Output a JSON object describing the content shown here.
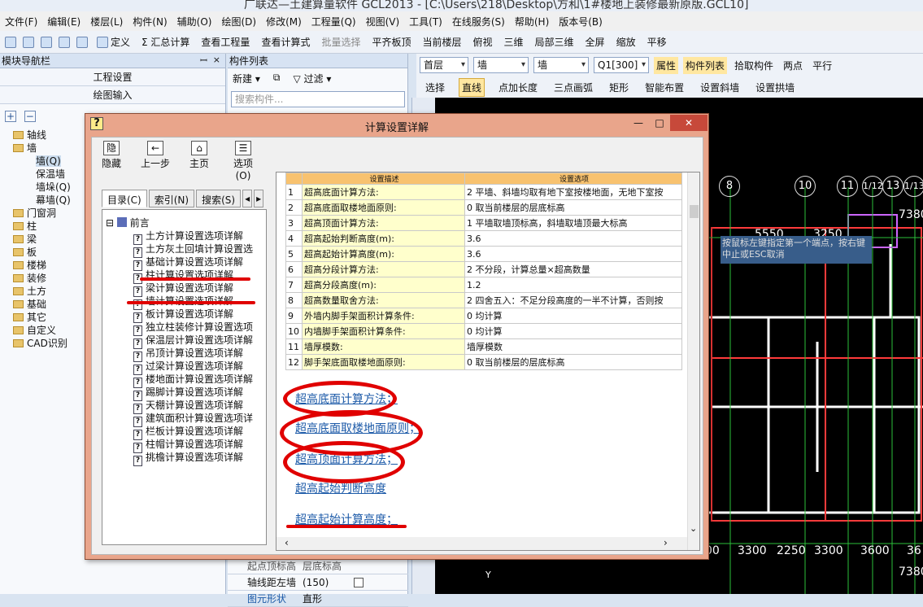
{
  "app": {
    "title": "广联达—土建算量软件 GCL2013 - [C:\\Users\\218\\Desktop\\方和\\1#楼地上装修最新原版.GCL10]"
  },
  "menu": [
    "文件(F)",
    "编辑(E)",
    "楼层(L)",
    "构件(N)",
    "辅助(O)",
    "绘图(D)",
    "修改(M)",
    "工程量(Q)",
    "视图(V)",
    "工具(T)",
    "在线服务(S)",
    "帮助(H)",
    "版本号(B)"
  ],
  "toolbar1": [
    "定义",
    "Σ 汇总计算",
    "查看工程量",
    "查看计算式",
    "批量选择",
    "平齐板顶",
    "当前楼层",
    "俯视",
    "三维",
    "局部三维",
    "全屏",
    "缩放",
    "平移"
  ],
  "cad_toolbar": {
    "floor": "首层",
    "type1": "墙",
    "type2": "墙",
    "component": "Q1[300]",
    "btns": [
      "属性",
      "构件列表",
      "拾取构件",
      "两点",
      "平行"
    ],
    "row2": [
      "选择",
      "直线",
      "点加长度",
      "三点画弧",
      "矩形",
      "智能布置",
      "设置斜墙",
      "设置拱墙"
    ]
  },
  "nav_panel": {
    "title": "模块导航栏",
    "btn1": "工程设置",
    "btn2": "绘图输入",
    "tree": [
      "轴线",
      "墙",
      "墙(Q)",
      "保温墙",
      "墙垛(Q)",
      "幕墙(Q)",
      "门窗洞",
      "柱",
      "梁",
      "板",
      "楼梯",
      "装修",
      "土方",
      "基础",
      "其它",
      "自定义",
      "CAD识别"
    ]
  },
  "comp_panel": {
    "title": "构件列表",
    "new_btn": "新建",
    "filter_btn": "过滤",
    "search_placeholder": "搜索构件...",
    "rows": [
      {
        "label": "轴线距左墙",
        "value": "(150)"
      },
      {
        "label": "图元形状",
        "value": "直形"
      }
    ],
    "partial_row": {
      "label": "起点顶标高",
      "value": "层底标高"
    }
  },
  "dialog": {
    "title": "计算设置详解",
    "tools": [
      {
        "icon": "隐",
        "label": "隐藏"
      },
      {
        "icon": "←",
        "label": "上一步"
      },
      {
        "icon": "⌂",
        "label": "主页"
      },
      {
        "icon": "☰",
        "label": "选项(O)"
      }
    ],
    "tabs": [
      "目录(C)",
      "索引(N)",
      "搜索(S)"
    ],
    "toc_root": "前言",
    "toc_items": [
      "土方计算设置选项详解",
      "土方灰土回填计算设置选",
      "基础计算设置选项详解",
      "柱计算设置选项详解",
      "梁计算设置选项详解",
      "墙计算设置选项详解",
      "板计算设置选项详解",
      "独立柱装修计算设置选项",
      "保温层计算设置选项详解",
      "吊顶计算设置选项详解",
      "过梁计算设置选项详解",
      "楼地面计算设置选项详解",
      "踢脚计算设置选项详解",
      "天棚计算设置选项详解",
      "建筑面积计算设置选项详",
      "栏板计算设置选项详解",
      "柱帽计算设置选项详解",
      "挑檐计算设置选项详解"
    ],
    "grid_header": {
      "desc": "设置描述",
      "opt": "设置选项"
    },
    "grid_rows": [
      {
        "n": "1",
        "desc": "超高底面计算方法:",
        "opt": "2 平墙、斜墙均取有地下室按楼地面，无地下室按"
      },
      {
        "n": "2",
        "desc": "超高底面取楼地面原则:",
        "opt": "0 取当前楼层的层底标高"
      },
      {
        "n": "3",
        "desc": "超高顶面计算方法:",
        "opt": "1 平墙取墙顶标高，斜墙取墙顶最大标高"
      },
      {
        "n": "4",
        "desc": "超高起始判断高度(m):",
        "opt": "3.6"
      },
      {
        "n": "5",
        "desc": "超高起始计算高度(m):",
        "opt": "3.6"
      },
      {
        "n": "6",
        "desc": "超高分段计算方法:",
        "opt": "2 不分段，计算总量×超高数量"
      },
      {
        "n": "7",
        "desc": "超高分段高度(m):",
        "opt": "1.2"
      },
      {
        "n": "8",
        "desc": "超高数量取舍方法:",
        "opt": "2 四舍五入：不足分段高度的一半不计算，否则按"
      },
      {
        "n": "9",
        "desc": "外墙内脚手架面积计算条件:",
        "opt": "0 均计算"
      },
      {
        "n": "10",
        "desc": "内墙脚手架面积计算条件:",
        "opt": "0 均计算"
      },
      {
        "n": "11",
        "desc": "墙厚模数:",
        "opt": "墙厚模数"
      },
      {
        "n": "12",
        "desc": "脚手架底面取楼地面原则:",
        "opt": "0 取当前楼层的层底标高"
      }
    ],
    "links": [
      "超高底面计算方法；",
      "超高底面取楼地面原则；",
      "超高顶面计算方法；",
      "超高起始判断高度",
      "超高起始计算高度；"
    ]
  },
  "canvas": {
    "axes": [
      "8",
      "10",
      "11",
      "1/12",
      "13",
      "1/13"
    ],
    "dims_top": [
      "5550",
      "3250",
      "7380"
    ],
    "dims_bottom": [
      "00",
      "3300",
      "2250",
      "3300",
      "3600",
      "36"
    ],
    "dim_right": "7380",
    "tooltip": "按鼠标左键指定第一个端点，按右键中止或ESC取消"
  }
}
